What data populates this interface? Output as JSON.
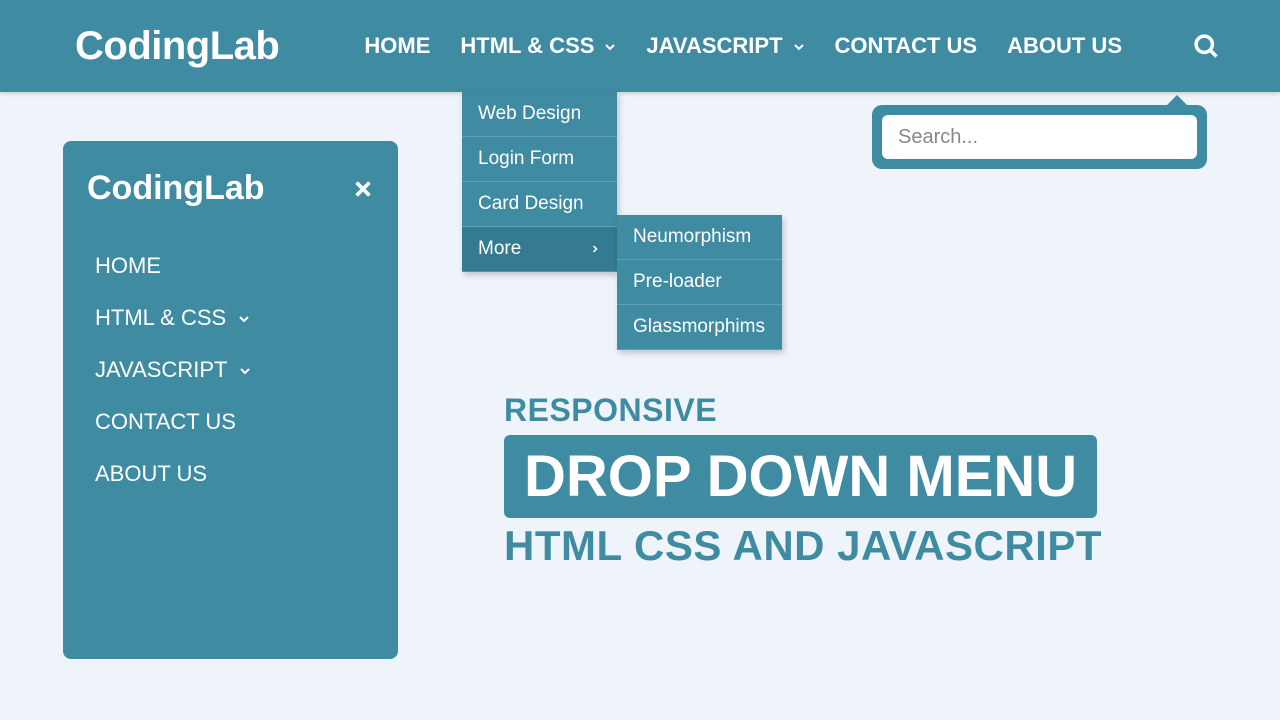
{
  "brand": "CodingLab",
  "nav": {
    "home": "HOME",
    "htmlcss": "HTML & CSS",
    "javascript": "JAVASCRIPT",
    "contact": "CONTACT US",
    "about": "ABOUT US"
  },
  "dropdown": {
    "webdesign": "Web Design",
    "loginform": "Login Form",
    "carddesign": "Card Design",
    "more": "More"
  },
  "dropdown2": {
    "neumorphism": "Neumorphism",
    "preloader": "Pre-loader",
    "glassmorphims": "Glassmorphims"
  },
  "search": {
    "placeholder": "Search..."
  },
  "sidebar": {
    "brand": "CodingLab",
    "home": "HOME",
    "htmlcss": "HTML & CSS",
    "javascript": "JAVASCRIPT",
    "contact": "CONTACT US",
    "about": "ABOUT US"
  },
  "hero": {
    "sub": "RESPONSIVE",
    "main": "DROP DOWN MENU",
    "foot": "HTML CSS AND JAVASCRIPT"
  }
}
